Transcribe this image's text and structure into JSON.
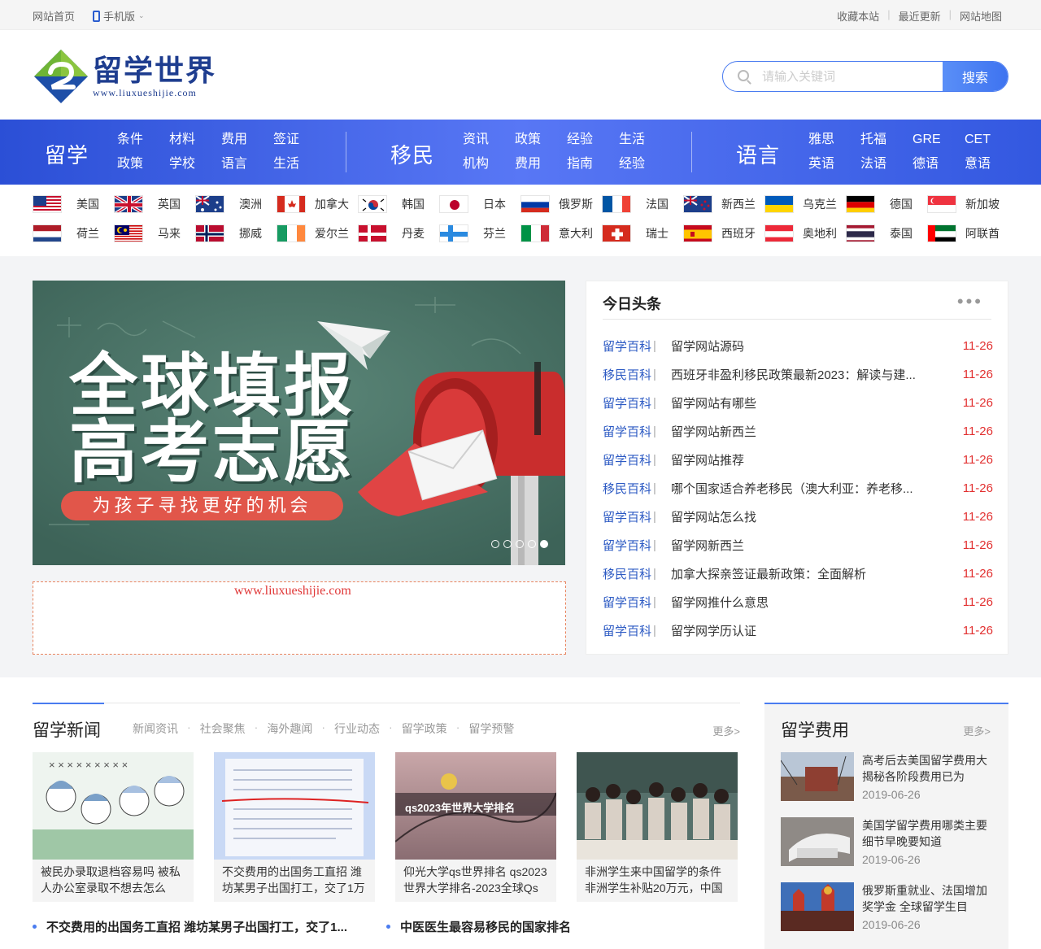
{
  "topbar": {
    "home": "网站首页",
    "mobile": "手机版",
    "links": [
      "收藏本站",
      "最近更新",
      "网站地图"
    ]
  },
  "logo": {
    "title": "留学世界",
    "url": "www.liuxueshijie.com"
  },
  "search": {
    "placeholder": "请输入关键词",
    "button": "搜索"
  },
  "nav": [
    {
      "title": "留学",
      "links": [
        "条件",
        "材料",
        "费用",
        "签证",
        "政策",
        "学校",
        "语言",
        "生活"
      ]
    },
    {
      "title": "移民",
      "links": [
        "资讯",
        "政策",
        "经验",
        "生活",
        "机构",
        "费用",
        "指南",
        "经验"
      ]
    },
    {
      "title": "语言",
      "links": [
        "雅思",
        "托福",
        "GRE",
        "CET",
        "英语",
        "法语",
        "德语",
        "意语"
      ]
    }
  ],
  "countries": [
    "美国",
    "英国",
    "澳洲",
    "加拿大",
    "韩国",
    "日本",
    "俄罗斯",
    "法国",
    "新西兰",
    "乌克兰",
    "德国",
    "新加坡",
    "荷兰",
    "马来",
    "挪威",
    "爱尔兰",
    "丹麦",
    "芬兰",
    "意大利",
    "瑞士",
    "西班牙",
    "奥地利",
    "泰国",
    "阿联酋"
  ],
  "banner": {
    "line1": "全球填报",
    "line2": "高考志愿",
    "pill": "为孩子寻找更好的机会",
    "slides": 5,
    "active_slide": 5
  },
  "ad": {
    "text": "www.liuxueshijie.com"
  },
  "headlines": {
    "title": "今日头条",
    "items": [
      {
        "cat": "留学百科",
        "title": "留学网站源码",
        "date": "11-26"
      },
      {
        "cat": "移民百科",
        "title": "西班牙非盈利移民政策最新2023：解读与建...",
        "date": "11-26"
      },
      {
        "cat": "留学百科",
        "title": "留学网站有哪些",
        "date": "11-26"
      },
      {
        "cat": "留学百科",
        "title": "留学网站新西兰",
        "date": "11-26"
      },
      {
        "cat": "留学百科",
        "title": "留学网站推荐",
        "date": "11-26"
      },
      {
        "cat": "移民百科",
        "title": "哪个国家适合养老移民（澳大利亚：养老移...",
        "date": "11-26"
      },
      {
        "cat": "留学百科",
        "title": "留学网站怎么找",
        "date": "11-26"
      },
      {
        "cat": "留学百科",
        "title": "留学网新西兰",
        "date": "11-26"
      },
      {
        "cat": "移民百科",
        "title": "加拿大探亲签证最新政策：全面解析",
        "date": "11-26"
      },
      {
        "cat": "留学百科",
        "title": "留学网推什么意思",
        "date": "11-26"
      },
      {
        "cat": "留学百科",
        "title": "留学网学历认证",
        "date": "11-26"
      }
    ]
  },
  "study_news": {
    "title": "留学新闻",
    "tabs": [
      "新闻资讯",
      "社会聚焦",
      "海外趣闻",
      "行业动态",
      "留学政策",
      "留学预警"
    ],
    "more": "更多>",
    "cards": [
      {
        "title": "被民办录取退档容易吗 被私人办公室录取不想去怎么"
      },
      {
        "title": "不交费用的出国务工直招 潍坊某男子出国打工，交了1万"
      },
      {
        "title": "仰光大学qs世界排名 qs2023世界大学排名-2023全球Qs",
        "overlay": "qs2023年世界大学排名"
      },
      {
        "title": "非洲学生来中国留学的条件 非洲学生补贴20万元，中国"
      }
    ],
    "bullets": [
      "不交费用的出国务工直招 潍坊某男子出国打工，交了1...",
      "中医医生最容易移民的国家排名"
    ]
  },
  "study_fees": {
    "title": "留学费用",
    "more": "更多>",
    "items": [
      {
        "title": "高考后去美国留学费用大揭秘各阶段费用已为",
        "date": "2019-06-26"
      },
      {
        "title": "美国学留学费用哪类主要细节早晚要知道",
        "date": "2019-06-26"
      },
      {
        "title": "俄罗斯重就业、法国增加奖学金 全球留学生目",
        "date": "2019-06-26"
      }
    ]
  },
  "colors": {
    "brand_blue": "#3e73f0",
    "date_red": "#e23131",
    "category_blue": "#2b59c3"
  }
}
